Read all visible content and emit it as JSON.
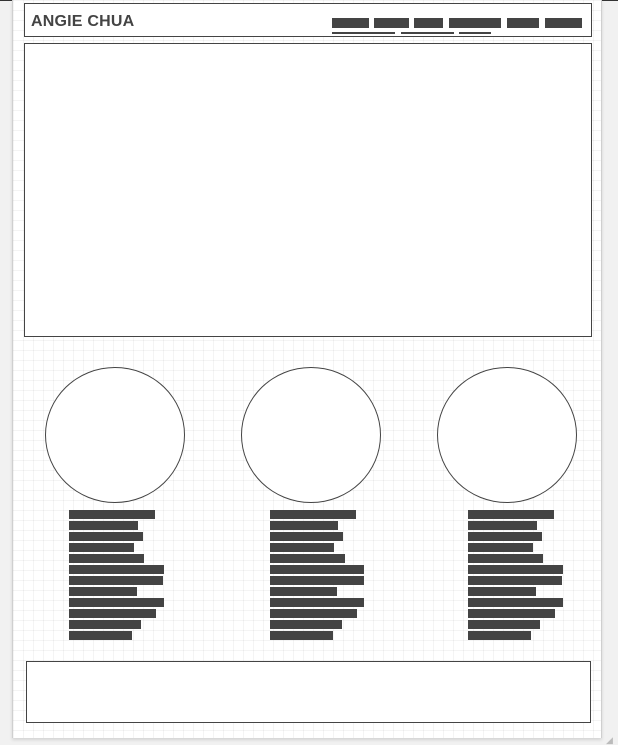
{
  "brand": {
    "name": "ANGIE CHUA"
  },
  "nav": {
    "items": [
      "nav-1",
      "nav-2",
      "nav-3",
      "nav-4",
      "nav-5",
      "nav-6"
    ],
    "placeholder_color": "#444444"
  },
  "colors": {
    "stroke": "#444444",
    "canvas": "#ffffff",
    "background": "#f1f1f1",
    "grid": "#eaeaea"
  },
  "icons": {
    "resize": "resize-grip-icon"
  }
}
